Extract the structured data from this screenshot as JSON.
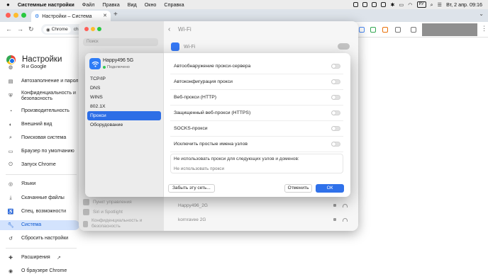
{
  "menubar": {
    "app_name": "Системные настройки",
    "items": [
      "Файл",
      "Правка",
      "Вид",
      "Окно",
      "Справка"
    ],
    "keyboard": "РУ",
    "clock": "Вт, 2 апр.  09:16"
  },
  "browser": {
    "tab_title": "Настройки – Система",
    "site_chip": "Chrome",
    "url_fragment": "ch"
  },
  "settings": {
    "title": "Настройки",
    "sidebar": [
      {
        "label": "Я и Google",
        "icon": "person-icon"
      },
      {
        "label": "Автозаполнение и пароли",
        "icon": "autofill-icon"
      },
      {
        "label": "Конфиденциальность и безопасность",
        "icon": "shield-icon"
      },
      {
        "label": "Производительность",
        "icon": "speedometer-icon"
      },
      {
        "label": "Внешний вид",
        "icon": "palette-icon"
      },
      {
        "label": "Поисковая система",
        "icon": "search-icon"
      },
      {
        "label": "Браузер по умолчанию",
        "icon": "browser-icon"
      },
      {
        "label": "Запуск Chrome",
        "icon": "power-icon"
      },
      {
        "label": "Языки",
        "icon": "globe-icon"
      },
      {
        "label": "Скачанные файлы",
        "icon": "download-icon"
      },
      {
        "label": "Спец. возможности",
        "icon": "accessibility-icon"
      },
      {
        "label": "Система",
        "icon": "wrench-icon",
        "active": true
      },
      {
        "label": "Сбросить настройки",
        "icon": "reset-icon"
      },
      {
        "label": "Расширения",
        "icon": "puzzle-icon"
      },
      {
        "label": "О браузере Chrome",
        "icon": "chrome-icon"
      }
    ]
  },
  "system_settings": {
    "search_placeholder": "Поиск",
    "title": "Wi-Fi",
    "wifi_label": "Wi-Fi",
    "background_sidebar": [
      "Пункт управления",
      "Siri и Spotlight",
      "Конфиденциальность и безопасность"
    ],
    "networks": [
      "Happy496_2G",
      "kornravee 2G"
    ]
  },
  "dialog": {
    "network_name": "Happy496 5G",
    "network_status": "Подключено",
    "tabs": [
      "TCP/IP",
      "DNS",
      "WINS",
      "802.1X",
      "Прокси",
      "Оборудование"
    ],
    "selected_tab": "Прокси",
    "options": [
      {
        "label": "Автообнаружение прокси-сервера",
        "enabled": false
      },
      {
        "label": "Автоконфигурация прокси",
        "enabled": false
      },
      {
        "label": "Веб-прокси (HTTP)",
        "enabled": false
      },
      {
        "label": "Защищенный веб-прокси (HTTPS)",
        "enabled": false
      },
      {
        "label": "SOCKS-прокси",
        "enabled": false
      },
      {
        "label": "Исключить простые имена узлов",
        "enabled": false
      }
    ],
    "bypass_label": "Не использовать прокси для следующих узлов и доменов:",
    "bypass_placeholder": "Не использовать прокси",
    "forget_button": "Забыть эту сеть...",
    "cancel_button": "Отменить",
    "ok_button": "ОК"
  },
  "colors": {
    "accent": "#2f71ea",
    "active_sidebar_bg": "#d3e3fd",
    "wifi_icon": "#2e7cf6"
  }
}
